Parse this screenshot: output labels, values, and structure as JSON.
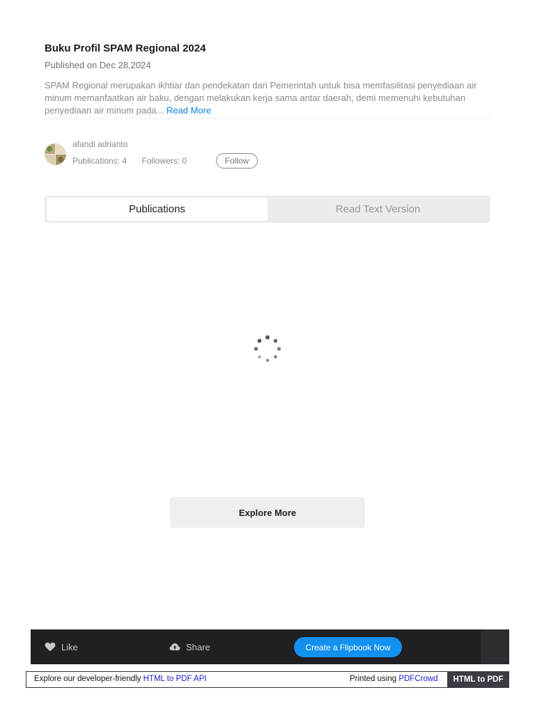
{
  "publication": {
    "title": "Buku Profil SPAM Regional 2024",
    "published": "Published on Dec 28,2024",
    "description": "SPAM Regional merupakan ikhtiar dan pendekatan dari Pemerintah untuk bisa memfasilitasi penyediaan air minum memanfaatkan air baku, dengan melakukan kerja sama antar daerah, demi memenuhi kebutuhan penyediaan air minum pada...",
    "read_more": "Read More"
  },
  "author": {
    "name": "afandi adrianto",
    "publications": "Publications: 4",
    "followers": "Followers: 0",
    "follow_label": "Follow"
  },
  "tabs": [
    {
      "label": "Publications",
      "active": true
    },
    {
      "label": "Read Text Version",
      "active": false
    }
  ],
  "explore_label": "Explore More",
  "bottom_bar": {
    "like": "Like",
    "share": "Share",
    "create": "Create a Flipbook Now"
  },
  "pdfcrowd": {
    "left_text": "Explore our developer-friendly ",
    "left_link": "HTML to PDF API",
    "right_text": "Printed using ",
    "right_link": "PDFCrowd",
    "button": "HTML to PDF"
  },
  "colors": {
    "accent": "#1391f0",
    "link": "#0a84e6",
    "bar_bg": "#1f1f24"
  }
}
